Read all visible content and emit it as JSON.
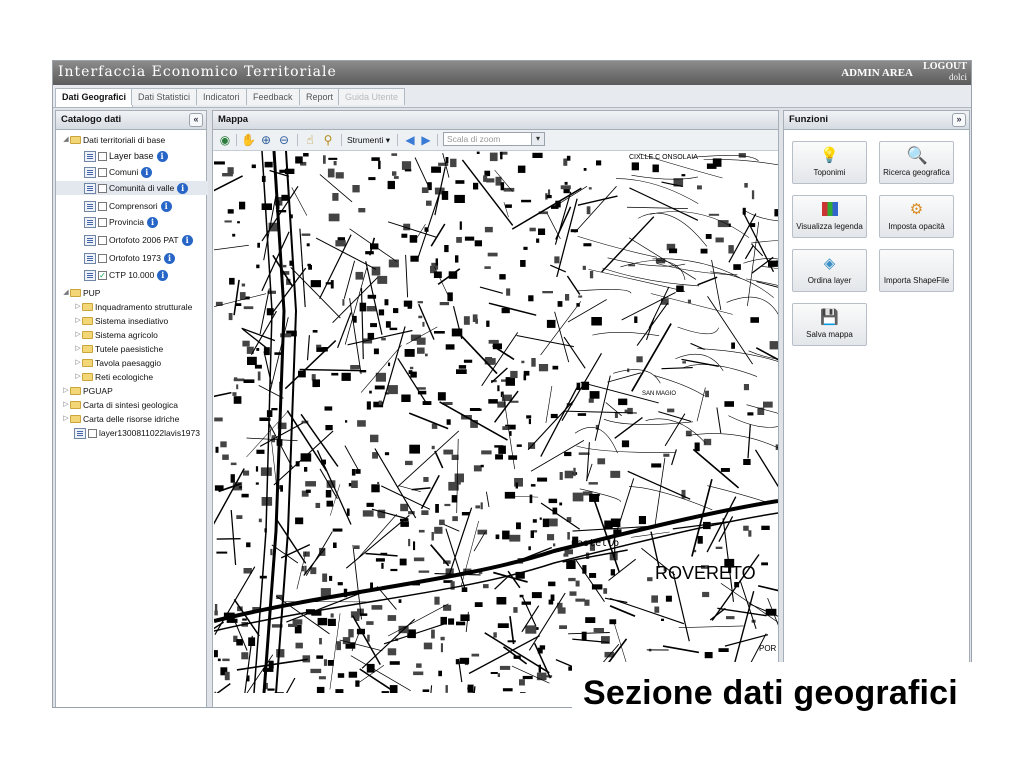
{
  "header": {
    "title": "Interfaccia Economico Territoriale",
    "admin": "ADMIN AREA",
    "logout": "LOGOUT",
    "user": "dolci"
  },
  "tabs": [
    {
      "label": "Dati Geografici",
      "state": "active"
    },
    {
      "label": "Dati Statistici",
      "state": "normal"
    },
    {
      "label": "Indicatori",
      "state": "normal"
    },
    {
      "label": "Feedback",
      "state": "normal"
    },
    {
      "label": "Report",
      "state": "normal"
    },
    {
      "label": "Guida Utente",
      "state": "disabled"
    }
  ],
  "catalog": {
    "title": "Catalogo dati",
    "collapse_icon": "double-chevron-left",
    "items": [
      {
        "label": "Dati territoriali di base",
        "type": "folder",
        "expanded": true
      },
      {
        "label": "Layer base",
        "type": "layer",
        "checked": false,
        "info": true
      },
      {
        "label": "Comuni",
        "type": "layer",
        "checked": false,
        "info": true
      },
      {
        "label": "Comunità di valle",
        "type": "layer",
        "checked": false,
        "info": true,
        "highlighted": true
      },
      {
        "label": "Comprensori",
        "type": "layer",
        "checked": false,
        "info": true
      },
      {
        "label": "Provincia",
        "type": "layer",
        "checked": false,
        "info": true
      },
      {
        "label": "Ortofoto 2006 PAT",
        "type": "layer",
        "checked": false,
        "info": true
      },
      {
        "label": "Ortofoto 1973",
        "type": "layer",
        "checked": false,
        "info": true
      },
      {
        "label": "CTP 10.000",
        "type": "layer",
        "checked": true,
        "info": true
      },
      {
        "label": "PUP",
        "type": "folder",
        "expanded": true
      },
      {
        "label": "Inquadramento strutturale",
        "type": "folder",
        "expanded": false
      },
      {
        "label": "Sistema insediativo",
        "type": "folder",
        "expanded": false
      },
      {
        "label": "Sistema agricolo",
        "type": "folder",
        "expanded": false
      },
      {
        "label": "Tutele paesistiche",
        "type": "folder",
        "expanded": false
      },
      {
        "label": "Tavola paesaggio",
        "type": "folder",
        "expanded": false
      },
      {
        "label": "Reti ecologiche",
        "type": "folder",
        "expanded": false
      },
      {
        "label": "PGUAP",
        "type": "folder",
        "expanded": false
      },
      {
        "label": "Carta di sintesi geologica",
        "type": "folder",
        "expanded": false
      },
      {
        "label": "Carta delle risorse idriche",
        "type": "folder",
        "expanded": false
      },
      {
        "label": "layer1300811022lavis1973",
        "type": "layer",
        "checked": false,
        "info": false
      }
    ]
  },
  "map": {
    "title": "Mappa",
    "strumenti": "Strumenti",
    "zoom_placeholder": "Scala di zoom",
    "labels": {
      "castello": "Castello",
      "roverto": "ROVERETO",
      "top": "CIXLLE C\nONSOLAIA",
      "sanmagio": "SAN MAGIO",
      "por": "POR"
    }
  },
  "functions": {
    "title": "Funzioni",
    "collapse_icon": "double-chevron-right",
    "buttons": [
      {
        "label": "Toponimi",
        "icon": "lightbulb-icon"
      },
      {
        "label": "Ricerca geografica",
        "icon": "magnifier-icon"
      },
      {
        "label": "Visualizza legenda",
        "icon": "legend-icon"
      },
      {
        "label": "Imposta opacità",
        "icon": "tools-icon"
      },
      {
        "label": "Ordina layer",
        "icon": "layers-icon"
      },
      {
        "label": "Importa ShapeFile",
        "icon": ""
      },
      {
        "label": "Salva mappa",
        "icon": "save-icon"
      }
    ]
  },
  "caption": "Sezione dati geografici"
}
